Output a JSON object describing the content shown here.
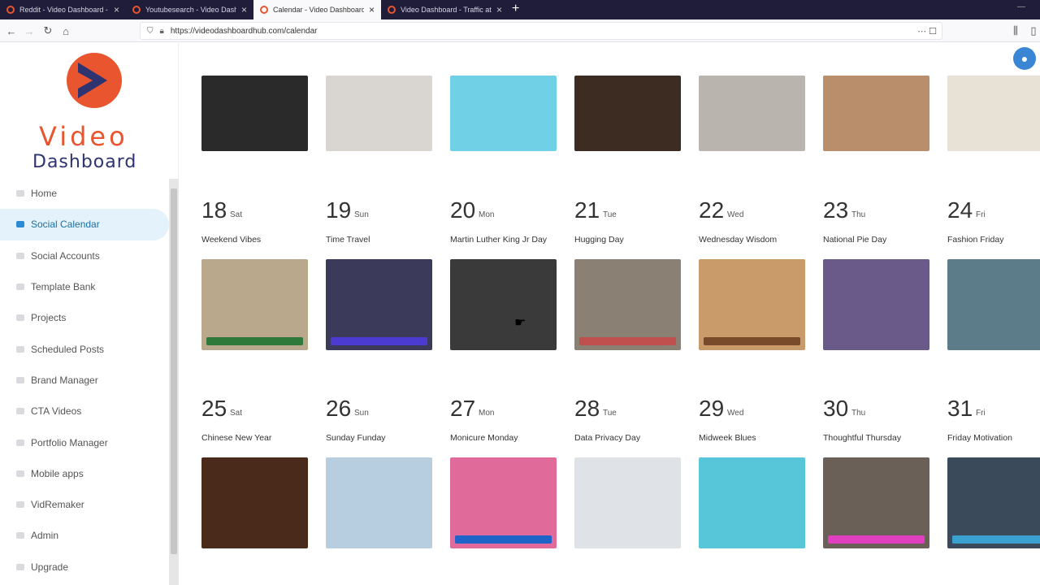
{
  "browser": {
    "tabs": [
      {
        "label": "Reddit - Video Dashboard - Tr",
        "active": false
      },
      {
        "label": "Youtubesearch - Video Dashb",
        "active": false
      },
      {
        "label": "Calendar - Video Dashboard -",
        "active": true
      },
      {
        "label": "Video Dashboard - Traffic at i",
        "active": false
      }
    ],
    "url": "https://videodashboardhub.com/calendar"
  },
  "brand": {
    "line1": "Video",
    "line2": "Dashboard"
  },
  "sidebar": {
    "items": [
      {
        "label": "Home",
        "active": false
      },
      {
        "label": "Social Calendar",
        "active": true
      },
      {
        "label": "Social Accounts",
        "active": false
      },
      {
        "label": "Template Bank",
        "active": false
      },
      {
        "label": "Projects",
        "active": false
      },
      {
        "label": "Scheduled Posts",
        "active": false
      },
      {
        "label": "Brand Manager",
        "active": false
      },
      {
        "label": "CTA Videos",
        "active": false
      },
      {
        "label": "Portfolio Manager",
        "active": false
      },
      {
        "label": "Mobile apps",
        "active": false
      },
      {
        "label": "VidRemaker",
        "active": false
      },
      {
        "label": "Admin",
        "active": false
      },
      {
        "label": "Upgrade",
        "active": false
      }
    ]
  },
  "calendar": {
    "top_row_colors": [
      "#2a2a2a",
      "#d9d6d2",
      "#6fd0e6",
      "#3c2c22",
      "#b9b4ad",
      "#b88f6a",
      "#e8e2d6"
    ],
    "weeks": [
      {
        "days": [
          {
            "num": "18",
            "dow": "Sat",
            "theme": "Weekend Vibes",
            "color": "#b9a88b",
            "accent": "#2f7a3a"
          },
          {
            "num": "19",
            "dow": "Sun",
            "theme": "Time Travel",
            "color": "#3b3a5a",
            "accent": "#4b3bd0"
          },
          {
            "num": "20",
            "dow": "Mon",
            "theme": "Martin Luther King Jr Day",
            "color": "#3a3a3a",
            "accent": ""
          },
          {
            "num": "21",
            "dow": "Tue",
            "theme": "Hugging Day",
            "color": "#8a8074",
            "accent": "#c0504d"
          },
          {
            "num": "22",
            "dow": "Wed",
            "theme": "Wednesday Wisdom",
            "color": "#c99a6a",
            "accent": "#7a4b2a"
          },
          {
            "num": "23",
            "dow": "Thu",
            "theme": "National Pie Day",
            "color": "#6a5a8a",
            "accent": ""
          },
          {
            "num": "24",
            "dow": "Fri",
            "theme": "Fashion Friday",
            "color": "#5b7c88",
            "accent": ""
          }
        ]
      },
      {
        "days": [
          {
            "num": "25",
            "dow": "Sat",
            "theme": "Chinese New Year",
            "color": "#4a2a1a",
            "accent": ""
          },
          {
            "num": "26",
            "dow": "Sun",
            "theme": "Sunday Funday",
            "color": "#b7cde0",
            "accent": ""
          },
          {
            "num": "27",
            "dow": "Mon",
            "theme": "Monicure Monday",
            "color": "#e06a9a",
            "accent": "#1d63c8"
          },
          {
            "num": "28",
            "dow": "Tue",
            "theme": "Data Privacy Day",
            "color": "#dfe3e8",
            "accent": ""
          },
          {
            "num": "29",
            "dow": "Wed",
            "theme": "Midweek Blues",
            "color": "#56c6d8",
            "accent": ""
          },
          {
            "num": "30",
            "dow": "Thu",
            "theme": "Thoughtful Thursday",
            "color": "#6a6058",
            "accent": "#e040c0"
          },
          {
            "num": "31",
            "dow": "Fri",
            "theme": "Friday Motivation",
            "color": "#3a4a5a",
            "accent": "#3aa0d0"
          }
        ]
      }
    ]
  }
}
